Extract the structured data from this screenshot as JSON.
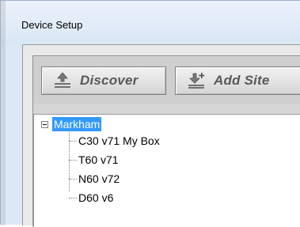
{
  "window": {
    "title": "Device Setup"
  },
  "toolbar": {
    "discover_label": "Discover",
    "add_site_label": "Add Site"
  },
  "tree": {
    "root": {
      "label": "Markham",
      "expanded": true,
      "selected": true
    },
    "children": [
      {
        "label": "C30 v71 My Box"
      },
      {
        "label": "T60 v71"
      },
      {
        "label": "N60 v72"
      },
      {
        "label": "D60 v6"
      }
    ]
  },
  "colors": {
    "selection": "#3399ff",
    "button_text": "#595959",
    "title_bar": "#dbe9f6"
  },
  "icons": {
    "discover": "discover-icon",
    "add_site": "add-site-icon",
    "collapse": "collapse-minus-icon"
  }
}
